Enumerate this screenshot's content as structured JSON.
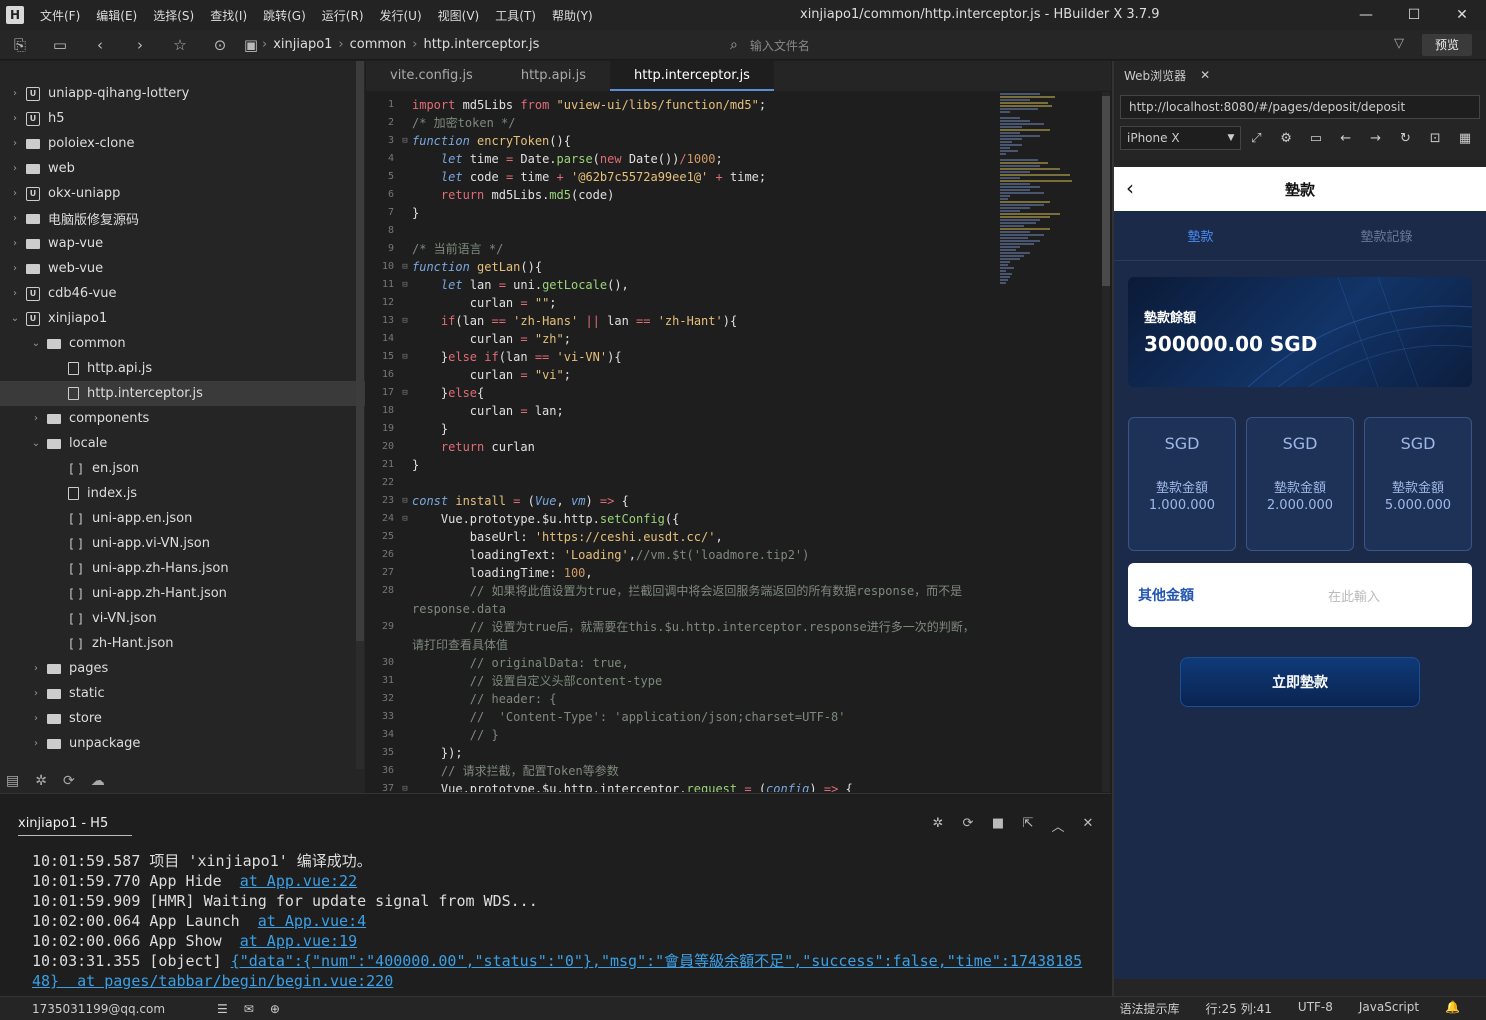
{
  "title": {
    "menus": [
      "文件(F)",
      "编辑(E)",
      "选择(S)",
      "查找(I)",
      "跳转(G)",
      "运行(R)",
      "发行(U)",
      "视图(V)",
      "工具(T)",
      "帮助(Y)"
    ],
    "text": "xinjiapo1/common/http.interceptor.js - HBuilder X 3.7.9"
  },
  "toolbar": {
    "crumbs": [
      "xinjiapo1",
      "common",
      "http.interceptor.js"
    ],
    "file_placeholder": "输入文件名",
    "preview": "预览"
  },
  "tree": [
    {
      "label": "uniapp-qihang-lottery",
      "depth": 0,
      "icon": "proj",
      "tw": "›"
    },
    {
      "label": "h5",
      "depth": 0,
      "icon": "proj",
      "tw": "›"
    },
    {
      "label": "poloiex-clone",
      "depth": 0,
      "icon": "folder",
      "tw": "›"
    },
    {
      "label": "web",
      "depth": 0,
      "icon": "folder",
      "tw": "›"
    },
    {
      "label": "okx-uniapp",
      "depth": 0,
      "icon": "proj",
      "tw": "›"
    },
    {
      "label": "电脑版修复源码",
      "depth": 0,
      "icon": "folder",
      "tw": "›"
    },
    {
      "label": "wap-vue",
      "depth": 0,
      "icon": "folder",
      "tw": "›"
    },
    {
      "label": "web-vue",
      "depth": 0,
      "icon": "folder",
      "tw": "›"
    },
    {
      "label": "cdb46-vue",
      "depth": 0,
      "icon": "proj",
      "tw": "›"
    },
    {
      "label": "xinjiapo1",
      "depth": 0,
      "icon": "proj",
      "tw": "⌄"
    },
    {
      "label": "common",
      "depth": 1,
      "icon": "folder",
      "tw": "⌄"
    },
    {
      "label": "http.api.js",
      "depth": 2,
      "icon": "file",
      "tw": ""
    },
    {
      "label": "http.interceptor.js",
      "depth": 2,
      "icon": "file",
      "tw": "",
      "sel": true
    },
    {
      "label": "components",
      "depth": 1,
      "icon": "folder",
      "tw": "›"
    },
    {
      "label": "locale",
      "depth": 1,
      "icon": "folder",
      "tw": "⌄"
    },
    {
      "label": "en.json",
      "depth": 2,
      "icon": "json",
      "tw": ""
    },
    {
      "label": "index.js",
      "depth": 2,
      "icon": "file",
      "tw": ""
    },
    {
      "label": "uni-app.en.json",
      "depth": 2,
      "icon": "json",
      "tw": ""
    },
    {
      "label": "uni-app.vi-VN.json",
      "depth": 2,
      "icon": "json",
      "tw": ""
    },
    {
      "label": "uni-app.zh-Hans.json",
      "depth": 2,
      "icon": "json",
      "tw": ""
    },
    {
      "label": "uni-app.zh-Hant.json",
      "depth": 2,
      "icon": "json",
      "tw": ""
    },
    {
      "label": "vi-VN.json",
      "depth": 2,
      "icon": "json",
      "tw": ""
    },
    {
      "label": "zh-Hant.json",
      "depth": 2,
      "icon": "json",
      "tw": ""
    },
    {
      "label": "pages",
      "depth": 1,
      "icon": "folder",
      "tw": "›"
    },
    {
      "label": "static",
      "depth": 1,
      "icon": "folder",
      "tw": "›"
    },
    {
      "label": "store",
      "depth": 1,
      "icon": "folder",
      "tw": "›"
    },
    {
      "label": "unpackage",
      "depth": 1,
      "icon": "folder",
      "tw": "›"
    }
  ],
  "editor_tabs": [
    "vite.config.js",
    "http.api.js",
    "http.interceptor.js"
  ],
  "code_lines": [
    {
      "n": "1",
      "f": "",
      "h": "<span class='kw'>import</span> md5Libs <span class='kw'>from</span> <span class='str'>\"uview-ui/libs/function/md5\"</span>;"
    },
    {
      "n": "2",
      "f": "",
      "h": "<span class='cm'>/* 加密token */</span>"
    },
    {
      "n": "3",
      "f": "⊟",
      "h": "<span class='it'>function</span> <span class='fn'>encryToken</span>(){"
    },
    {
      "n": "4",
      "f": "",
      "h": "    <span class='it'>let</span> time <span class='op'>=</span> Date.<span class='mth'>parse</span>(<span class='kw'>new</span> Date())<span class='op'>/</span><span class='num'>1000</span>;"
    },
    {
      "n": "5",
      "f": "",
      "h": "    <span class='it'>let</span> code <span class='op'>=</span> time <span class='op'>+</span> <span class='str'>'@62b7c5572a99ee1@'</span> <span class='op'>+</span> time;"
    },
    {
      "n": "6",
      "f": "",
      "h": "    <span class='kw'>return</span> md5Libs.<span class='mth'>md5</span>(code)"
    },
    {
      "n": "7",
      "f": "",
      "h": "}"
    },
    {
      "n": "8",
      "f": "",
      "h": ""
    },
    {
      "n": "9",
      "f": "",
      "h": "<span class='cm'>/* 当前语言 */</span>"
    },
    {
      "n": "10",
      "f": "⊟",
      "h": "<span class='it'>function</span> <span class='fn'>getLan</span>(){"
    },
    {
      "n": "11",
      "f": "⊟",
      "h": "    <span class='it'>let</span> lan <span class='op'>=</span> uni.<span class='mth'>getLocale</span>(),"
    },
    {
      "n": "12",
      "f": "",
      "h": "        curlan <span class='op'>=</span> <span class='str'>\"\"</span>;"
    },
    {
      "n": "13",
      "f": "⊟",
      "h": "    <span class='kw'>if</span>(lan <span class='op'>==</span> <span class='str'>'zh-Hans'</span> <span class='op'>||</span> lan <span class='op'>==</span> <span class='str'>'zh-Hant'</span>){"
    },
    {
      "n": "14",
      "f": "",
      "h": "        curlan <span class='op'>=</span> <span class='str'>\"zh\"</span>;"
    },
    {
      "n": "15",
      "f": "⊟",
      "h": "    }<span class='kw'>else if</span>(lan <span class='op'>==</span> <span class='str'>'vi-VN'</span>){"
    },
    {
      "n": "16",
      "f": "",
      "h": "        curlan <span class='op'>=</span> <span class='str'>\"vi\"</span>;"
    },
    {
      "n": "17",
      "f": "⊟",
      "h": "    }<span class='kw'>else</span>{"
    },
    {
      "n": "18",
      "f": "",
      "h": "        curlan <span class='op'>=</span> lan;"
    },
    {
      "n": "19",
      "f": "",
      "h": "    }"
    },
    {
      "n": "20",
      "f": "",
      "h": "    <span class='kw'>return</span> curlan"
    },
    {
      "n": "21",
      "f": "",
      "h": "}"
    },
    {
      "n": "22",
      "f": "",
      "h": ""
    },
    {
      "n": "23",
      "f": "⊟",
      "h": "<span class='it'>const</span> <span class='fn'>install</span> <span class='op'>=</span> (<span class='it'>Vue</span>, <span class='it'>vm</span>) <span class='op'>=></span> {"
    },
    {
      "n": "24",
      "f": "⊟",
      "h": "    Vue.prototype.$u.http.<span class='mth'>setConfig</span>({"
    },
    {
      "n": "25",
      "f": "",
      "h": "        baseUrl: <span class='str'>'https://ceshi.eusdt.cc/'</span>,"
    },
    {
      "n": "26",
      "f": "",
      "h": "        loadingText: <span class='str'>'Loading'</span>,<span class='cm'>//vm.$t('loadmore.tip2')</span>"
    },
    {
      "n": "27",
      "f": "",
      "h": "        loadingTime: <span class='num'>100</span>,"
    },
    {
      "n": "28",
      "f": "",
      "h": "        <span class='cm'>// 如果将此值设置为true，拦截回调中将会返回服务端返回的所有数据response，而不是</span>"
    },
    {
      "n": "",
      "f": "",
      "h": "<span class='cm'>response.data</span>"
    },
    {
      "n": "29",
      "f": "",
      "h": "        <span class='cm'>// 设置为true后，就需要在this.$u.http.interceptor.response进行多一次的判断，</span>"
    },
    {
      "n": "",
      "f": "",
      "h": "<span class='cm'>请打印查看具体值</span>"
    },
    {
      "n": "30",
      "f": "",
      "h": "        <span class='cm'>// originalData: true,</span>"
    },
    {
      "n": "31",
      "f": "",
      "h": "        <span class='cm'>// 设置自定义头部content-type</span>"
    },
    {
      "n": "32",
      "f": "",
      "h": "        <span class='cm'>// header: {</span>"
    },
    {
      "n": "33",
      "f": "",
      "h": "        <span class='cm'>//  'Content-Type': 'application/json;charset=UTF-8'</span>"
    },
    {
      "n": "34",
      "f": "",
      "h": "        <span class='cm'>// }</span>"
    },
    {
      "n": "35",
      "f": "",
      "h": "    });"
    },
    {
      "n": "36",
      "f": "",
      "h": "    <span class='cm'>// 请求拦截，配置Token等参数</span>"
    },
    {
      "n": "37",
      "f": "⊟",
      "h": "    Vue.prototype.$u.http.interceptor.<span class='mth'>request</span> <span class='op'>=</span> (<span class='it'>config</span>) <span class='op'>=></span> {"
    }
  ],
  "browser": {
    "tab": "Web浏览器",
    "url": "http://localhost:8080/#/pages/deposit/deposit",
    "device": "iPhone X"
  },
  "app": {
    "header": "墊款",
    "tabs": [
      "墊款",
      "墊款記錄"
    ],
    "balance_label": "墊款餘額",
    "balance": "300000.00 SGD",
    "options": [
      {
        "cur": "SGD",
        "val": "1.000.000",
        "sl": "墊款金額",
        "sv": "1.000.000"
      },
      {
        "cur": "SGD",
        "val": "2.000.000",
        "sl": "墊款金額",
        "sv": "2.000.000"
      },
      {
        "cur": "SGD",
        "val": "5.000.000",
        "sl": "墊款金額",
        "sv": "5.000.000"
      }
    ],
    "other_label": "其他金額",
    "other_placeholder": "在此輸入",
    "submit": "立即墊款"
  },
  "console": {
    "tab": "xinjiapo1 - H5",
    "lines": [
      {
        "t": "10:01:59.587 项目 'xinjiapo1' 编译成功。",
        "l": ""
      },
      {
        "t": "10:01:59.770 App Hide  ",
        "l": "at App.vue:22"
      },
      {
        "t": "10:01:59.909 [HMR] Waiting for update signal from WDS...",
        "l": ""
      },
      {
        "t": "10:02:00.064 App Launch  ",
        "l": "at App.vue:4"
      },
      {
        "t": "10:02:00.066 App Show  ",
        "l": "at App.vue:19"
      },
      {
        "t": "10:03:31.355 [object] ",
        "l": "{\"data\":{\"num\":\"400000.00\",\"status\":\"0\"},\"msg\":\"會員等級余額不足\",\"success\":false,\"time\":17438185"
      },
      {
        "t": "",
        "l": "48}  at pages/tabbar/begin/begin.vue:220"
      }
    ]
  },
  "status": {
    "email": "1735031199@qq.com",
    "right": [
      "语法提示库",
      "行:25  列:41",
      "UTF-8",
      "JavaScript"
    ]
  }
}
